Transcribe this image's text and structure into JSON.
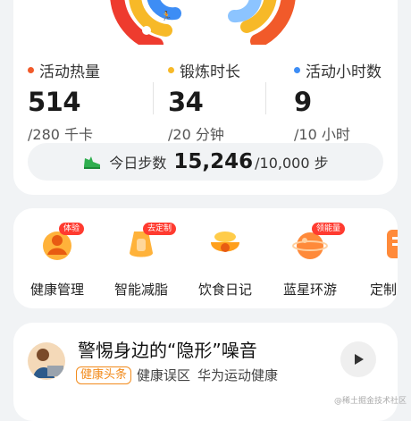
{
  "metrics": [
    {
      "label": "活动热量",
      "value": "514",
      "goal": "/280 千卡",
      "color": "#f15a2a"
    },
    {
      "label": "锻炼时长",
      "value": "34",
      "goal": "/20 分钟",
      "color": "#f7b928"
    },
    {
      "label": "活动小时数",
      "value": "9",
      "goal": "/10 小时",
      "color": "#3d8df5"
    }
  ],
  "steps": {
    "label": "今日步数",
    "value": "15,246",
    "goal": "/10,000 步",
    "icon": "shoe-icon"
  },
  "apps": [
    {
      "label": "健康管理",
      "badge": "体验",
      "icon": "health-management-icon"
    },
    {
      "label": "智能减脂",
      "badge": "去定制",
      "icon": "fat-loss-icon"
    },
    {
      "label": "饮食日记",
      "badge": "",
      "icon": "diet-diary-icon"
    },
    {
      "label": "蓝星环游",
      "badge": "领能量",
      "icon": "planet-travel-icon"
    },
    {
      "label": "定制",
      "badge": "",
      "icon": "custom-plan-icon"
    }
  ],
  "news": {
    "title": "警惕身边的“隐形”噪音",
    "tag": "健康头条",
    "category": "健康误区",
    "source": "华为运动健康"
  },
  "watermark": "@稀土掘金技术社区"
}
